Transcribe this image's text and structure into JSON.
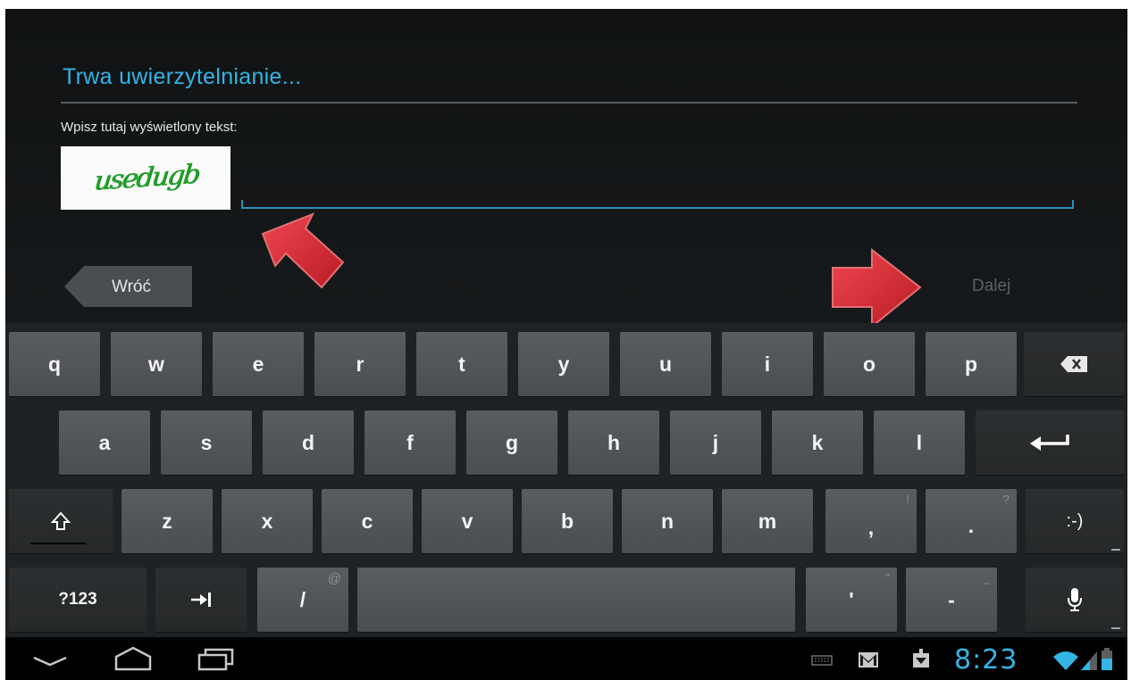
{
  "dialog": {
    "title": "Trwa uwierzytelnianie...",
    "prompt": "Wpisz tutaj wyświetlony tekst:",
    "captcha_text": "usedugb",
    "input_value": "",
    "back_label": "Wróć",
    "next_label": "Dalej"
  },
  "keyboard": {
    "row1": [
      "q",
      "w",
      "e",
      "r",
      "t",
      "y",
      "u",
      "i",
      "o",
      "p"
    ],
    "row2": [
      "a",
      "s",
      "d",
      "f",
      "g",
      "h",
      "j",
      "k",
      "l"
    ],
    "row3": [
      "z",
      "x",
      "c",
      "v",
      "b",
      "n",
      "m"
    ],
    "comma": ",",
    "comma_hint": "!",
    "period": ".",
    "period_hint": "?",
    "smiley": ":-)",
    "symbols": "?123",
    "slash": "/",
    "slash_hint": "@",
    "apostrophe": "'",
    "apostrophe_hint": "\"",
    "dash": "-",
    "dash_hint": "_"
  },
  "status": {
    "time": "8:23"
  },
  "colors": {
    "accent": "#33b5e5",
    "arrow": "#d4252e"
  }
}
